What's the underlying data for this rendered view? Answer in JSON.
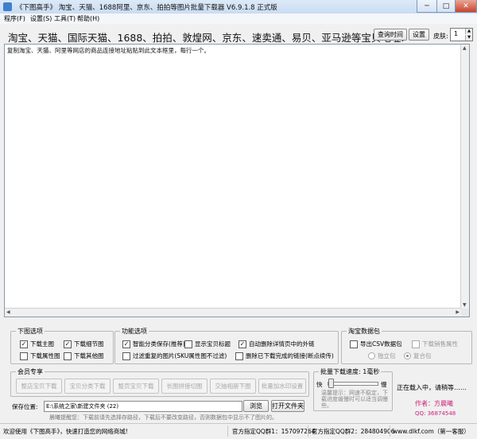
{
  "window": {
    "title": "《下图高手》 淘宝、天猫、1688阿里、京东、拍拍等图片批量下载器 V6.9.1.8 正式版",
    "minimize": "─",
    "maximize": "□",
    "close": "✕"
  },
  "menu": [
    "程序(F)",
    "设置(S)",
    "工具(T)",
    "帮助(H)"
  ],
  "url_label": "淘宝、天猫、国际天猫、1688、拍拍、敦煌网、京东、速卖通、易贝、亚马逊等宝贝地址:",
  "toolbar": {
    "query_time": "查询时间",
    "settings": "设置",
    "skin_label": "皮肤:",
    "skin_value": "1"
  },
  "input_area": {
    "text": "复制淘宝、天猫、阿里等网店的商品连接地址粘贴到此文本框里，每行一个。"
  },
  "download_options": {
    "title": "下图选项",
    "items": [
      {
        "label": "下载主图",
        "checked": true
      },
      {
        "label": "下载细节图",
        "checked": true
      },
      {
        "label": "下载属性图",
        "checked": false
      },
      {
        "label": "下载其他图",
        "checked": false
      }
    ]
  },
  "function_options": {
    "title": "功能选项",
    "items": [
      {
        "label": "智能分类保存(推荐)",
        "checked": true
      },
      {
        "label": "显示宝贝标题",
        "checked": false
      },
      {
        "label": "自动删除详情页中的外链",
        "checked": true
      },
      {
        "label": "过滤重复的图片(SKU属性图不过滤)",
        "checked": false
      },
      {
        "label": "删除已下载完成的链接(断点续传)",
        "checked": false
      }
    ]
  },
  "taobao_package": {
    "title": "淘宝数据包",
    "export_csv": "导出CSV数据包",
    "download_sales_attr": "下载销售属性",
    "radio_standalone": "独立包",
    "radio_combined": "复合包"
  },
  "vip": {
    "title": "会员专享",
    "buttons": [
      "整店宝贝下载",
      "宝贝分类下载",
      "整页宝贝下载",
      "长图拼接切图",
      "交抽相册下图",
      "批量加水印设置"
    ]
  },
  "speed": {
    "title": "批量下载速度: 1毫秒",
    "fast": "快",
    "slow": "慢",
    "level": 0.05,
    "tip": "温馨提示：网速不稳定，下载进度缓慢时可以适当调慢些。"
  },
  "save": {
    "label": "保存位置:",
    "path": "E:\\系统之家\\新建文件夹 (22)",
    "browse": "浏览",
    "open_folder": "打开文件夹",
    "note": "晨曦提醒您：下载前请先选择存路径，下载后不要改变路径，否则数据包中显示不了图片的。"
  },
  "status_side": {
    "loading": "正在载入中，请稍等……",
    "author": "作者：方晨曦",
    "qq": "QQ: 36874548"
  },
  "statusbar": {
    "welcome": "欢迎使用《下图高手》，快速打造您的网络商城!",
    "qq_group1": "官方指定QQ群1：157097264",
    "qq_group2": "官方指定QQ群2：284804906",
    "site": "www.dlkf.com（第一客服）"
  },
  "colors": {
    "author": "#cc2277",
    "titlebar": "#c9dcf2"
  }
}
